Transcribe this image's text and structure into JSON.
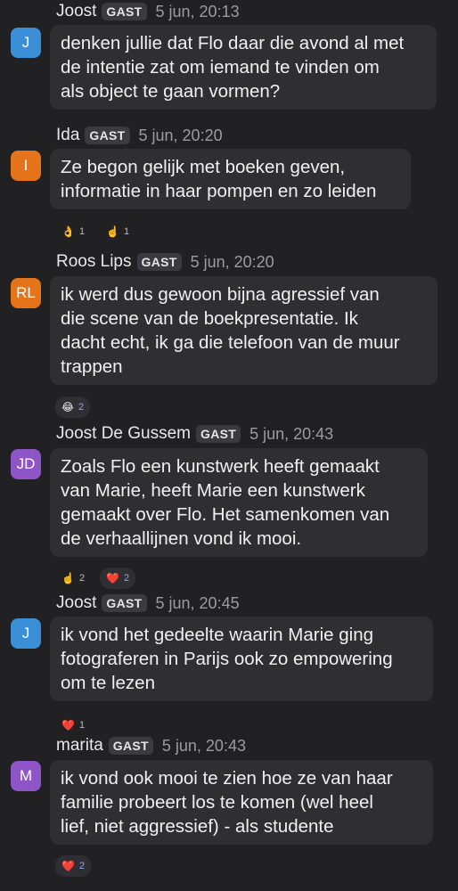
{
  "badge": "GAST",
  "messages": [
    {
      "initials": "J",
      "color": "#3a8fd6",
      "author": "Joost",
      "time": "5 jun, 20:13",
      "lines": [
        "denken jullie dat Flo daar die avond al met",
        "de intentie zat om iemand te vinden om",
        "als object te gaan vormen?"
      ],
      "reactions": []
    },
    {
      "initials": "I",
      "color": "#e4731a",
      "author": "Ida",
      "time": "5 jun, 20:20",
      "lines": [
        "Ze begon gelijk met boeken geven,",
        "informatie in haar pompen en zo leiden"
      ],
      "reactions": [
        {
          "emoji": "👌",
          "count": "1",
          "icon": "ok-hand-icon",
          "active": false
        },
        {
          "emoji": "☝️",
          "count": "1",
          "icon": "pointing-up-icon",
          "active": false
        }
      ]
    },
    {
      "initials": "RL",
      "color": "#e4731a",
      "author": "Roos Lips",
      "time": "5 jun, 20:20",
      "lines": [
        "ik werd dus gewoon bijna agressief van",
        "die scene van de boekpresentatie. Ik",
        "dacht echt, ik ga die telefoon van de muur",
        "trappen"
      ],
      "reactions": [
        {
          "emoji": "😂",
          "count": "2",
          "icon": "laughing-face-icon",
          "active": true
        }
      ]
    },
    {
      "initials": "JD",
      "color": "#8e55c6",
      "author": "Joost De Gussem",
      "time": "5 jun, 20:43",
      "lines": [
        "Zoals Flo een kunstwerk heeft gemaakt",
        "van Marie, heeft Marie een kunstwerk",
        "gemaakt over Flo. Het samenkomen van",
        "de verhaallijnen vond ik mooi."
      ],
      "reactions": [
        {
          "emoji": "☝️",
          "count": "2",
          "icon": "pointing-up-icon",
          "active": false
        },
        {
          "emoji": "❤️",
          "count": "2",
          "icon": "heart-icon",
          "active": true
        }
      ]
    },
    {
      "initials": "J",
      "color": "#3a8fd6",
      "author": "Joost",
      "time": "5 jun, 20:45",
      "lines": [
        "ik vond het gedeelte waarin Marie ging",
        "fotograferen in Parijs ook zo empowering",
        "om te lezen"
      ],
      "reactions": [
        {
          "emoji": "❤️",
          "count": "1",
          "icon": "heart-icon",
          "active": false
        }
      ]
    },
    {
      "initials": "M",
      "color": "#8e55c6",
      "author": "marita",
      "time": "5 jun, 20:43",
      "lines": [
        "ik vond ook mooi te zien hoe ze van haar",
        "familie probeert los te komen (wel heel",
        "lief, niet aggressief) - als studente"
      ],
      "reactions": [
        {
          "emoji": "❤️",
          "count": "2",
          "icon": "heart-icon",
          "active": true
        }
      ]
    }
  ]
}
